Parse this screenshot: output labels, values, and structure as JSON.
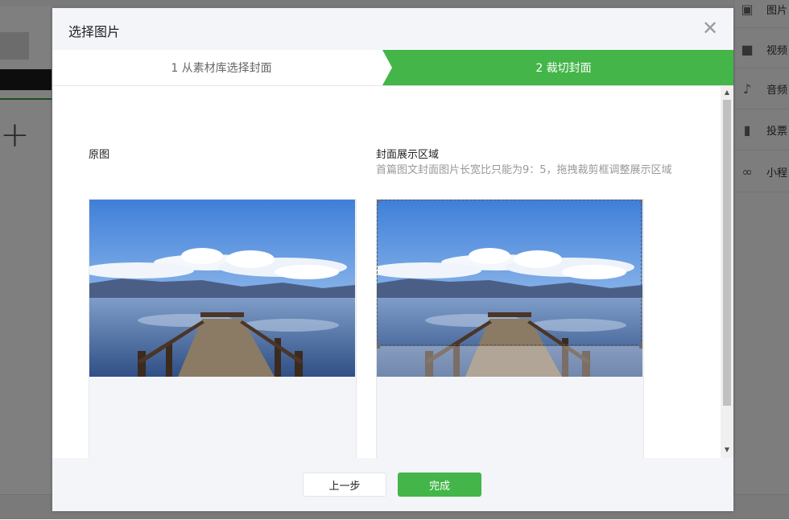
{
  "background": {
    "right_panel": [
      {
        "label": "图片",
        "icon": "image-icon"
      },
      {
        "label": "视频",
        "icon": "video-icon"
      },
      {
        "label": "音频",
        "icon": "microphone-icon"
      },
      {
        "label": "投票",
        "icon": "poll-icon"
      },
      {
        "label": "小程",
        "icon": "mini-program-icon"
      }
    ]
  },
  "dialog": {
    "title": "选择图片",
    "close_icon": "close-icon",
    "steps": [
      {
        "label": "1 从素材库选择封面",
        "active": false
      },
      {
        "label": "2 裁切封面",
        "active": true
      }
    ],
    "original_label": "原图",
    "cover_label": "封面展示区域",
    "cover_hint": "首篇图文封面图片长宽比只能为9：5，拖拽裁剪框调整展示区域",
    "buttons": {
      "prev": "上一步",
      "done": "完成"
    }
  },
  "colors": {
    "accent": "#44b549",
    "header_bg": "#f4f5f9",
    "overlay": "rgba(0,0,0,0.5)"
  }
}
